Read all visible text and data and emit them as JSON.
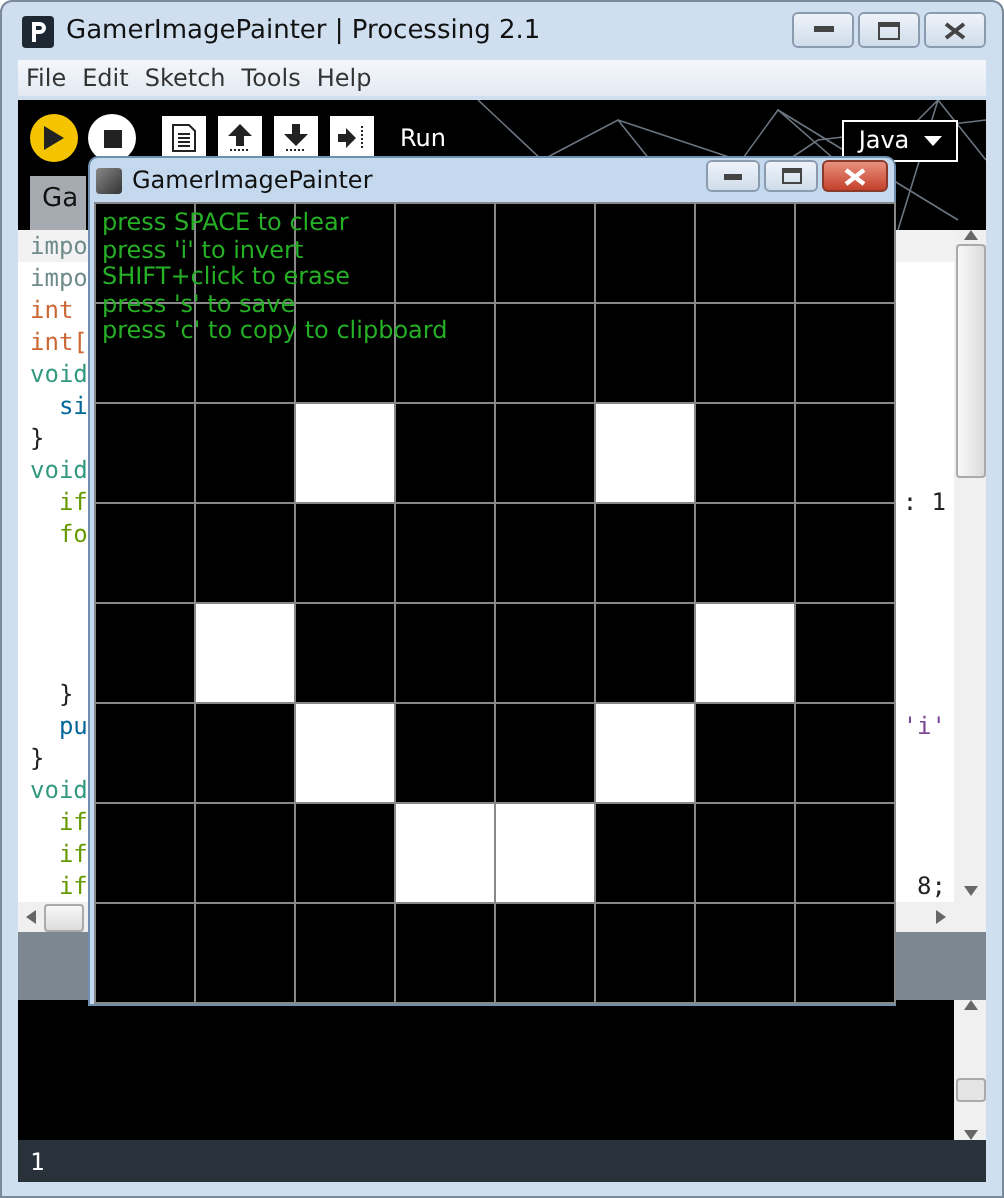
{
  "window": {
    "title": "GamerImagePainter | Processing 2.1"
  },
  "menu": [
    "File",
    "Edit",
    "Sketch",
    "Tools",
    "Help"
  ],
  "toolbar": {
    "hover_label": "Run",
    "mode": "Java"
  },
  "tabs": [
    {
      "label": "Ga",
      "selected": true
    }
  ],
  "code_lines": [
    {
      "kind": "import",
      "text": "impo"
    },
    {
      "kind": "import",
      "text": "impo"
    },
    {
      "kind": "type",
      "text": "int"
    },
    {
      "kind": "type",
      "text": "int["
    },
    {
      "kind": "void",
      "text": "void"
    },
    {
      "kind": "call",
      "text": "  si"
    },
    {
      "kind": "plain",
      "text": "}"
    },
    {
      "kind": "void",
      "text": "void"
    },
    {
      "kind": "control",
      "text": "  if",
      "tail": [
        {
          "kind": "plain",
          "text": ": 1"
        }
      ]
    },
    {
      "kind": "control",
      "text": "  fo"
    },
    {
      "kind": "blank"
    },
    {
      "kind": "blank"
    },
    {
      "kind": "blank"
    },
    {
      "kind": "blank"
    },
    {
      "kind": "plain",
      "text": "  }"
    },
    {
      "kind": "call",
      "text": "  pu",
      "tail": [
        {
          "kind": "string",
          "text": "'i'"
        }
      ]
    },
    {
      "kind": "plain",
      "text": "}"
    },
    {
      "kind": "void",
      "text": "void"
    },
    {
      "kind": "control",
      "text": "  if"
    },
    {
      "kind": "control",
      "text": "  if"
    },
    {
      "kind": "control",
      "text": "  if",
      "tail": [
        {
          "kind": "plain",
          "text": "8;"
        }
      ]
    }
  ],
  "status_line": "1",
  "sketch": {
    "title": "GamerImagePainter",
    "help_lines": [
      "press SPACE to clear",
      "press 'i' to invert",
      "SHIFT+click to erase",
      "press 's' to save",
      "press 'c' to copy to clipboard"
    ],
    "pixels": [
      [
        false,
        false,
        false,
        false,
        false,
        false,
        false,
        false
      ],
      [
        false,
        false,
        false,
        false,
        false,
        false,
        false,
        false
      ],
      [
        false,
        false,
        true,
        false,
        false,
        true,
        false,
        false
      ],
      [
        false,
        false,
        false,
        false,
        false,
        false,
        false,
        false
      ],
      [
        false,
        true,
        false,
        false,
        false,
        false,
        true,
        false
      ],
      [
        false,
        false,
        true,
        false,
        false,
        true,
        false,
        false
      ],
      [
        false,
        false,
        false,
        true,
        true,
        false,
        false,
        false
      ],
      [
        false,
        false,
        false,
        false,
        false,
        false,
        false,
        false
      ]
    ]
  }
}
